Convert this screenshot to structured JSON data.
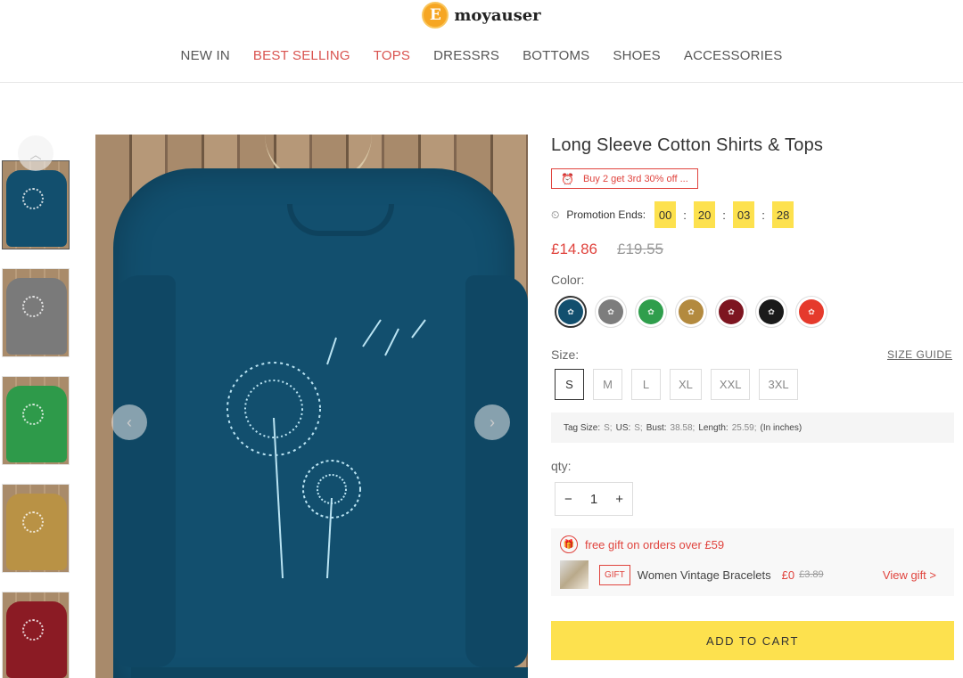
{
  "brand": {
    "logo_letter": "E",
    "name": "moyauser"
  },
  "nav": {
    "items": [
      {
        "label": "NEW IN"
      },
      {
        "label": "BEST SELLING"
      },
      {
        "label": "TOPS"
      },
      {
        "label": "DRESSRS"
      },
      {
        "label": "BOTTOMS"
      },
      {
        "label": "SHOES"
      },
      {
        "label": "ACCESSORIES"
      }
    ],
    "highlight_color": "#d9534f"
  },
  "gallery": {
    "thumbnails": [
      {
        "color": "#124f6e",
        "active": true
      },
      {
        "color": "#7a7a7a",
        "active": false
      },
      {
        "color": "#2e9a4a",
        "active": false
      },
      {
        "color": "#b99245",
        "active": false
      },
      {
        "color": "#8b1b24",
        "active": false
      }
    ],
    "up_icon": "chevron-up-icon",
    "prev_icon": "chevron-left-icon",
    "next_icon": "chevron-right-icon"
  },
  "product": {
    "title": "Long Sleeve Cotton Shirts & Tops",
    "promo_tag": "Buy 2 get 3rd 30% off ...",
    "countdown": {
      "label": "Promotion Ends:",
      "days": "00",
      "hours": "20",
      "minutes": "03",
      "seconds": "28"
    },
    "price": "£14.86",
    "old_price": "£19.55",
    "color_label": "Color:",
    "colors": [
      {
        "name": "Blue",
        "hex": "#124f6e",
        "selected": true
      },
      {
        "name": "Gray",
        "hex": "#7d7d7d",
        "selected": false
      },
      {
        "name": "Green",
        "hex": "#2f9e4c",
        "selected": false
      },
      {
        "name": "Yellow",
        "hex": "#b38a3f",
        "selected": false
      },
      {
        "name": "Wine",
        "hex": "#7d1520",
        "selected": false
      },
      {
        "name": "Black",
        "hex": "#1a1a1a",
        "selected": false
      },
      {
        "name": "Red",
        "hex": "#e53a2c",
        "selected": false
      }
    ],
    "size_label": "Size:",
    "size_guide": "SIZE GUIDE",
    "sizes": [
      {
        "label": "S",
        "selected": true
      },
      {
        "label": "M",
        "selected": false
      },
      {
        "label": "L",
        "selected": false
      },
      {
        "label": "XL",
        "selected": false
      },
      {
        "label": "XXL",
        "selected": false
      },
      {
        "label": "3XL",
        "selected": false
      }
    ],
    "size_info": {
      "tag_size_label": "Tag Size:",
      "tag_size": "S;",
      "us_label": "US:",
      "us": "S;",
      "bust_label": "Bust:",
      "bust": "38.58;",
      "length_label": "Length:",
      "length": "25.59;",
      "unit": "(In inches)"
    },
    "qty_label": "qty:",
    "qty": {
      "minus": "−",
      "value": "1",
      "plus": "+"
    },
    "gift": {
      "headline": "free gift on orders over £59",
      "badge": "GIFT",
      "name": "Women Vintage Bracelets",
      "price": "£0",
      "old_price": "£3.89",
      "link": "View gift >"
    },
    "add_to_cart": "ADD TO CART"
  },
  "colors": {
    "accent_red": "#e0443e",
    "accent_yellow": "#fde14e"
  }
}
